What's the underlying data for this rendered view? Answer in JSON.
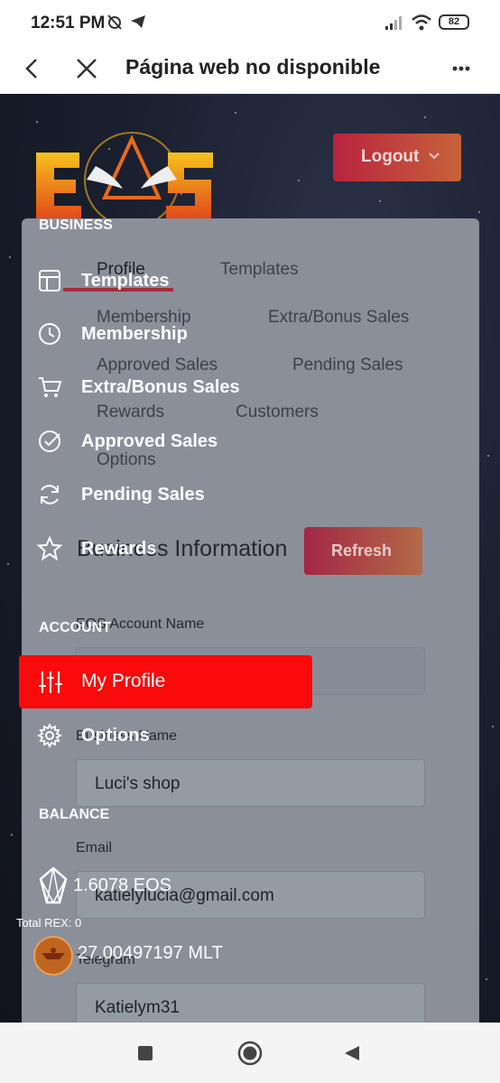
{
  "status_bar": {
    "time": "12:51 PM",
    "battery": "82"
  },
  "browser": {
    "title": "Página web no disponible"
  },
  "header": {
    "logout_label": "Logout"
  },
  "tabs": [
    {
      "label": "Profile"
    },
    {
      "label": "Templates"
    },
    {
      "label": "Membership"
    },
    {
      "label": "Extra/Bonus Sales"
    },
    {
      "label": "Approved Sales"
    },
    {
      "label": "Pending Sales"
    },
    {
      "label": "Rewards"
    },
    {
      "label": "Customers"
    },
    {
      "label": "Options"
    }
  ],
  "section": {
    "title": "Business Information",
    "refresh_label": "Refresh"
  },
  "form": {
    "eos_account_label": "EOS Account Name",
    "eos_account_value": "",
    "business_name_label": "Business Name",
    "business_name_value": "Luci's shop",
    "email_label": "Email",
    "email_value": "katielyluciа@gmail.com",
    "telegram_label": "Telegram",
    "telegram_value": "Katielym31"
  },
  "sidebar": {
    "business_heading": "BUSINESS",
    "business_items": [
      {
        "label": "Templates",
        "icon": "layout-icon"
      },
      {
        "label": "Membership",
        "icon": "clock-icon"
      },
      {
        "label": "Extra/Bonus Sales",
        "icon": "cart-icon"
      },
      {
        "label": "Approved Sales",
        "icon": "check-circle-icon"
      },
      {
        "label": "Pending Sales",
        "icon": "refresh-icon"
      },
      {
        "label": "Rewards",
        "icon": "star-icon"
      }
    ],
    "account_heading": "ACCOUNT",
    "account_items": [
      {
        "label": "My Profile",
        "icon": "sliders-icon",
        "active": true
      },
      {
        "label": "Options",
        "icon": "gear-icon"
      }
    ],
    "balance_heading": "BALANCE",
    "balances": [
      {
        "amount": "1.6078 EOS",
        "icon": "eos-icon"
      },
      {
        "amount": "27.00497197 MLT",
        "icon": "mlt-coin-icon"
      }
    ],
    "total_rex": "Total REX: 0"
  },
  "colors": {
    "active_item": "#fa0a0a",
    "accent": "#b8233e"
  }
}
